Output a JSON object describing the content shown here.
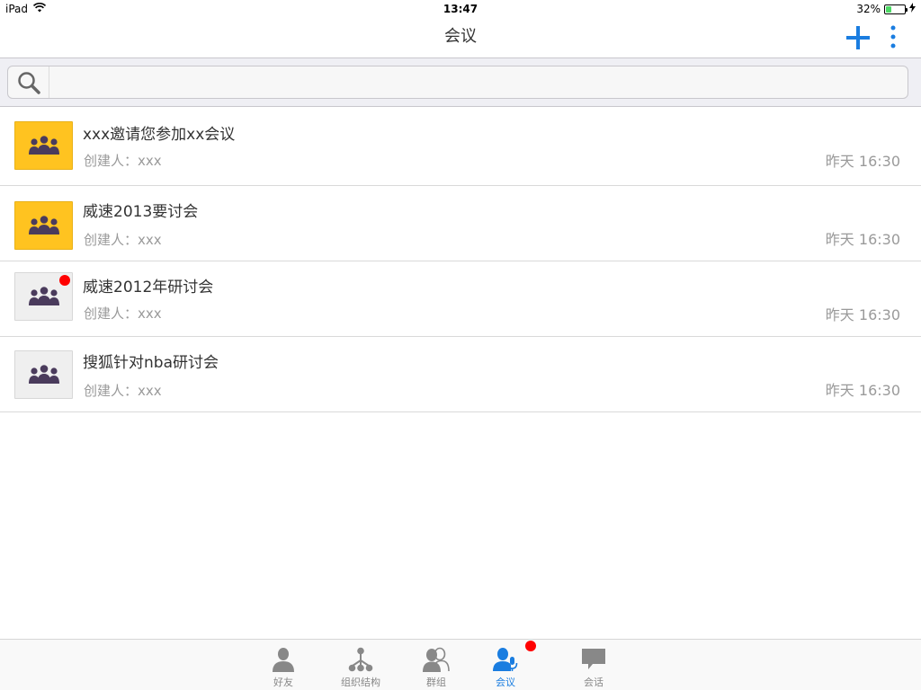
{
  "status_bar": {
    "carrier": "iPad",
    "time": "13:47",
    "battery_percent": "32%",
    "battery_level": 0.32,
    "icons": [
      "wifi-icon",
      "charging-icon"
    ]
  },
  "nav": {
    "title": "会议",
    "add_icon": "plus-icon",
    "more_icon": "more-vertical-icon",
    "accent_color": "#1a7de0"
  },
  "search": {
    "icon": "search-icon",
    "value": "",
    "placeholder": ""
  },
  "meetings": [
    {
      "title": "xxx邀请您参加xx会议",
      "creator": "创建人：xxx",
      "time": "昨天 16:30",
      "status": "active",
      "unread": false,
      "icon": "group-icon"
    },
    {
      "title": "威速2013要讨会",
      "creator": "创建人：xxx",
      "time": "昨天 16:30",
      "status": "active",
      "unread": false,
      "icon": "group-icon"
    },
    {
      "title": "威速2012年研讨会",
      "creator": "创建人：xxx",
      "time": "昨天 16:30",
      "status": "inactive",
      "unread": true,
      "icon": "group-icon"
    },
    {
      "title": "搜狐针对nba研讨会",
      "creator": "创建人：xxx",
      "time": "昨天 16:30",
      "status": "inactive",
      "unread": false,
      "icon": "group-icon"
    }
  ],
  "tabs": [
    {
      "label": "好友",
      "icon": "person-icon",
      "selected": false,
      "badge": false
    },
    {
      "label": "组织结构",
      "icon": "org-structure-icon",
      "selected": false,
      "badge": false
    },
    {
      "label": "群组",
      "icon": "people-group-icon",
      "selected": false,
      "badge": false
    },
    {
      "label": "会议",
      "icon": "meeting-mic-icon",
      "selected": true,
      "badge": true
    },
    {
      "label": "会话",
      "icon": "chat-bubble-icon",
      "selected": false,
      "badge": false
    }
  ],
  "colors": {
    "active_avatar_bg": "#ffc320",
    "inactive_avatar_bg": "#efefef",
    "badge_red": "#ff0000",
    "secondary_text": "#9a9a9a"
  }
}
